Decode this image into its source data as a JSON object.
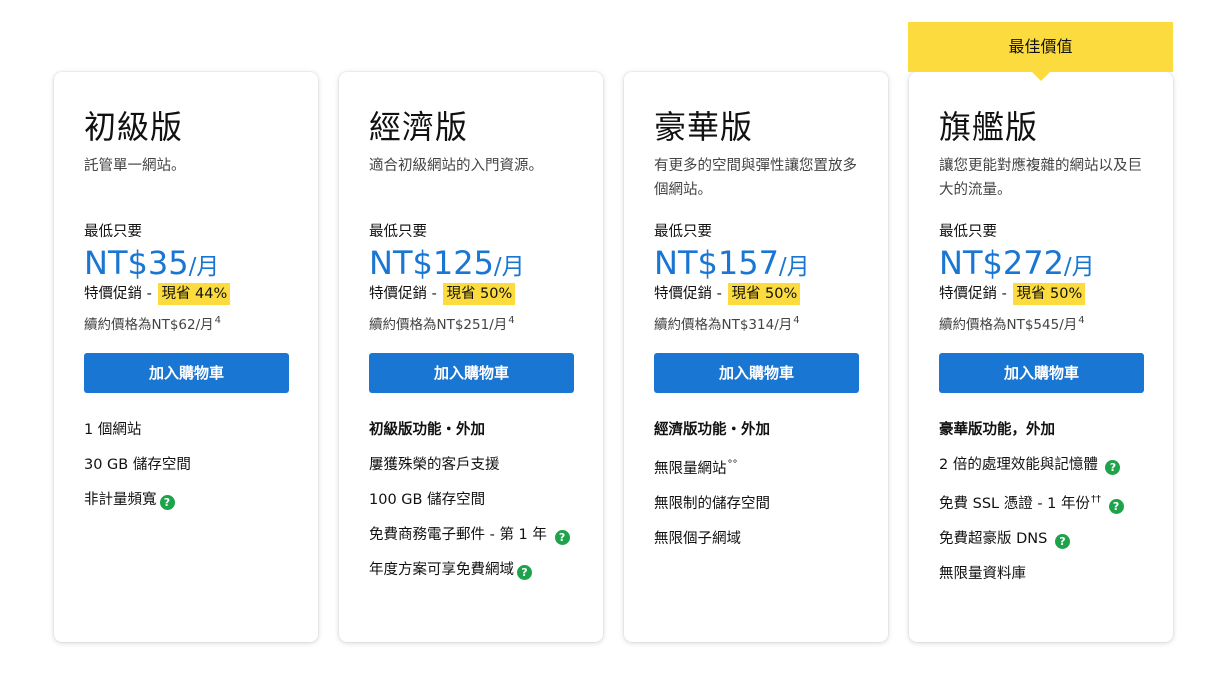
{
  "ribbon": {
    "label": "最佳價值"
  },
  "common": {
    "from_label": "最低只要",
    "price_unit": "/月",
    "promo_label": "特價促銷 -",
    "cart_label": "加入購物車",
    "help_icon": "?",
    "accent_color": "#1976d2",
    "highlight_color": "#fcdb3e",
    "help_icon_color": "#1ea34a"
  },
  "plans": [
    {
      "name": "初級版",
      "desc": "託管單一網站。",
      "price": "NT$35",
      "save": "現省 44%",
      "renew": "續約價格為NT$62/月",
      "renew_sup": "4",
      "features": [
        {
          "text": "1 個網站"
        },
        {
          "text": "30 GB 儲存空間"
        },
        {
          "text": "非計量頻寬",
          "icon": "help-icon"
        }
      ]
    },
    {
      "name": "經濟版",
      "desc": "適合初級網站的入門資源。",
      "price": "NT$125",
      "save": "現省 50%",
      "renew": "續約價格為NT$251/月",
      "renew_sup": "4",
      "features": [
        {
          "text": "初級版功能・外加",
          "head": true
        },
        {
          "text": "屢獲殊榮的客戶支援"
        },
        {
          "text": "100 GB 儲存空間"
        },
        {
          "text": "免費商務電子郵件 - 第 1 年",
          "icon": "help-icon"
        },
        {
          "text": "年度方案可享免費網域",
          "icon": "help-icon"
        }
      ]
    },
    {
      "name": "豪華版",
      "desc": "有更多的空間與彈性讓您置放多個網站。",
      "price": "NT$157",
      "save": "現省 50%",
      "renew": "續約價格為NT$314/月",
      "renew_sup": "4",
      "features": [
        {
          "text": "經濟版功能・外加",
          "head": true
        },
        {
          "text": "無限量網站",
          "sup": "°°"
        },
        {
          "text": "無限制的儲存空間"
        },
        {
          "text": "無限個子網域"
        }
      ]
    },
    {
      "name": "旗艦版",
      "desc": "讓您更能對應複雜的網站以及巨大的流量。",
      "price": "NT$272",
      "save": "現省 50%",
      "renew": "續約價格為NT$545/月",
      "renew_sup": "4",
      "features": [
        {
          "text": "豪華版功能，外加",
          "head": true
        },
        {
          "text": "2 倍的處理效能與記憶體",
          "icon": "help-icon"
        },
        {
          "text": "免費 SSL 憑證 - 1 年份",
          "sup": "††",
          "icon": "help-icon"
        },
        {
          "text": "免費超豪版 DNS",
          "icon": "help-icon"
        },
        {
          "text": "無限量資料庫"
        }
      ]
    }
  ]
}
